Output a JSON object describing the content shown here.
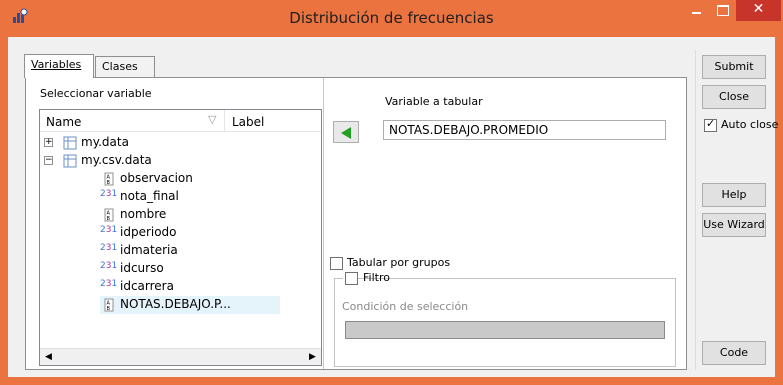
{
  "window": {
    "title": "Distribución de frecuencias",
    "close_glyph": "✕",
    "icon": "app-chart-icon"
  },
  "tabs": [
    {
      "label": "Variables",
      "active": true
    },
    {
      "label": "Clases",
      "active": false
    }
  ],
  "variables_panel": {
    "select_label": "Seleccionar variable",
    "tree_headers": {
      "name": "Name",
      "label": "Label"
    },
    "tree": [
      {
        "text": "my.data",
        "kind": "dataset",
        "expander": "+"
      },
      {
        "text": "my.csv.data",
        "kind": "dataset",
        "expander": "−"
      },
      {
        "text": "observacion",
        "kind": "text-var"
      },
      {
        "text": "nota_final",
        "kind": "numeric-var"
      },
      {
        "text": "nombre",
        "kind": "text-var"
      },
      {
        "text": "idperiodo",
        "kind": "numeric-var"
      },
      {
        "text": "idmateria",
        "kind": "numeric-var"
      },
      {
        "text": "idcurso",
        "kind": "numeric-var"
      },
      {
        "text": "idcarrera",
        "kind": "numeric-var"
      },
      {
        "text": "NOTAS.DEBAJO.P...",
        "kind": "text-var"
      }
    ],
    "selected_item": "NOTAS.DEBAJO.P...",
    "variable_label": "Variable a tabular",
    "variable_value": "NOTAS.DEBAJO.PROMEDIO",
    "group_label": "Tabular por grupos",
    "filter": {
      "label": "Filtro",
      "condition_label": "Condición de selección",
      "condition_value": ""
    }
  },
  "side_buttons": {
    "submit": "Submit",
    "close": "Close",
    "auto_close": "Auto close",
    "help": "Help",
    "wizard": "Use Wizard",
    "code": "Code"
  },
  "colors": {
    "title_bar": "#eb733f",
    "close_button": "#c7342a",
    "selection": "#e5f3fb",
    "arrow": "#22a022"
  }
}
